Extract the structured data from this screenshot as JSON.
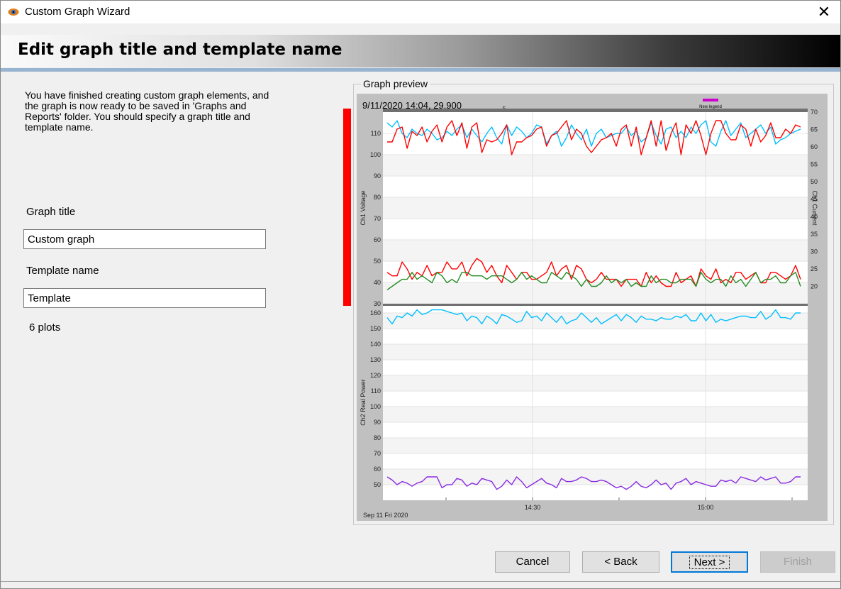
{
  "window": {
    "title": "Custom Graph Wizard",
    "close_symbol": "✕"
  },
  "header": {
    "title": "Edit graph title and template name"
  },
  "description": "You have finished creating custom graph elements, and the graph is now ready to be saved in 'Graphs and Reports' folder. You should specify a graph title and template name.",
  "form": {
    "graph_title_label": "Graph title",
    "graph_title_value": "Custom graph",
    "template_label": "Template name",
    "template_value": "Template",
    "plots_count": "6 plots"
  },
  "preview": {
    "group_label": "Graph preview",
    "cursor_readout": "9/11/2020 14:04, 29.900",
    "legend_label": "New legend",
    "legend_color": "#cc00cc",
    "date_label": "Sep 11 Fri 2020",
    "marker_color": "#ff0000"
  },
  "buttons": {
    "cancel": "Cancel",
    "back": "< Back",
    "next": "Next >",
    "finish": "Finish"
  },
  "chart_data": [
    {
      "type": "line",
      "ylabel": "Ch1 Voltage",
      "y2label": "Ch1 Current",
      "ylim": [
        30,
        120
      ],
      "y2lim": [
        15,
        70
      ],
      "yticks": [
        30,
        40,
        50,
        60,
        70,
        80,
        90,
        100,
        110
      ],
      "y2ticks": [
        20,
        25,
        30,
        35,
        40,
        45,
        50,
        55,
        60,
        65,
        70
      ],
      "xticks": [
        "14:30",
        "15:00"
      ],
      "series": [
        {
          "color": "#00bfff",
          "values": [
            115,
            113,
            116,
            110,
            108,
            112,
            110,
            109,
            112,
            110,
            107,
            108,
            111,
            109,
            112,
            114,
            108,
            112,
            109,
            106,
            110,
            113,
            108,
            105,
            114,
            109,
            113,
            111,
            108,
            110,
            114,
            113,
            105,
            109,
            111,
            104,
            108,
            114,
            110,
            107,
            112,
            104,
            110,
            112,
            108,
            109,
            110,
            110,
            113,
            109,
            111,
            106,
            108,
            115,
            109,
            105,
            112,
            113,
            108,
            111,
            108,
            113,
            110,
            114,
            116,
            106,
            104,
            111,
            116,
            109,
            112,
            115,
            108,
            110,
            112,
            114,
            110,
            113,
            105,
            107,
            108,
            110,
            111,
            112
          ]
        },
        {
          "color": "#ff0000",
          "values": [
            106,
            106,
            112,
            113,
            103,
            111,
            109,
            113,
            106,
            111,
            114,
            106,
            113,
            116,
            109,
            115,
            103,
            113,
            115,
            101,
            107,
            106,
            107,
            110,
            114,
            100,
            106,
            106,
            108,
            109,
            112,
            113,
            104,
            109,
            110,
            113,
            116,
            107,
            112,
            110,
            104,
            101,
            104,
            107,
            108,
            110,
            104,
            112,
            114,
            104,
            113,
            100,
            108,
            116,
            104,
            116,
            102,
            110,
            115,
            100,
            114,
            110,
            116,
            109,
            100,
            110,
            116,
            116,
            110,
            107,
            107,
            114,
            112,
            104,
            112,
            106,
            109,
            115,
            108,
            108,
            112,
            110,
            114,
            113
          ]
        },
        {
          "color": "#ff0000",
          "axis": "y2",
          "values": [
            24,
            23,
            23,
            27,
            25,
            22,
            24,
            23,
            26,
            23,
            24,
            24,
            27,
            25,
            25,
            27,
            23,
            26,
            28,
            27,
            24,
            26,
            23,
            21,
            26,
            24,
            22,
            24,
            24,
            22,
            22,
            23,
            24,
            27,
            23,
            25,
            26,
            22,
            26,
            25,
            22,
            21,
            22,
            24,
            22,
            22,
            22,
            20,
            22,
            22,
            22,
            20,
            24,
            21,
            23,
            21,
            20,
            20,
            24,
            21,
            22,
            23,
            20,
            25,
            23,
            22,
            25,
            21,
            22,
            21,
            24,
            24,
            22,
            23,
            24,
            21,
            21,
            24,
            24,
            23,
            22,
            23,
            26,
            22
          ]
        },
        {
          "color": "#228b22",
          "axis": "y2",
          "values": [
            19,
            20,
            21,
            22,
            22,
            24,
            22,
            23,
            22,
            21,
            24,
            23,
            21,
            22,
            21,
            24,
            24,
            23,
            23,
            23,
            22,
            23,
            23,
            23,
            22,
            21,
            22,
            24,
            22,
            23,
            22,
            21,
            21,
            24,
            23,
            22,
            24,
            23,
            22,
            20,
            22,
            20,
            20,
            21,
            23,
            21,
            22,
            21,
            22,
            20,
            21,
            20,
            20,
            23,
            21,
            22,
            22,
            21,
            21,
            22,
            22,
            22,
            20,
            24,
            22,
            21,
            22,
            22,
            20,
            23,
            21,
            22,
            20,
            22,
            24,
            21,
            22,
            22,
            23,
            21,
            21,
            23,
            24,
            20
          ]
        }
      ]
    },
    {
      "type": "line",
      "ylabel": "Ch2 Real Power",
      "ylim": [
        40,
        165
      ],
      "yticks": [
        50,
        60,
        70,
        80,
        90,
        100,
        110,
        120,
        130,
        140,
        150,
        160
      ],
      "xticks": [
        "14:30",
        "15:00"
      ],
      "series": [
        {
          "color": "#00bfff",
          "values": [
            157,
            153,
            158,
            157,
            160,
            158,
            162,
            159,
            160,
            162,
            162,
            162,
            161,
            160,
            159,
            160,
            155,
            158,
            157,
            153,
            158,
            156,
            153,
            159,
            158,
            156,
            154,
            155,
            161,
            157,
            158,
            155,
            160,
            157,
            154,
            158,
            153,
            155,
            156,
            160,
            157,
            154,
            157,
            153,
            155,
            157,
            159,
            155,
            159,
            157,
            154,
            158,
            156,
            156,
            155,
            157,
            156,
            156,
            158,
            157,
            159,
            155,
            155,
            160,
            155,
            159,
            154,
            156,
            155,
            156,
            157,
            158,
            158,
            157,
            157,
            161,
            156,
            158,
            162,
            157,
            157,
            156,
            160,
            160
          ]
        },
        {
          "color": "#8a2be2",
          "values": [
            55,
            53,
            50,
            52,
            51,
            49,
            51,
            52,
            55,
            55,
            55,
            48,
            50,
            50,
            54,
            53,
            49,
            51,
            50,
            54,
            53,
            52,
            47,
            49,
            53,
            50,
            55,
            52,
            48,
            50,
            52,
            54,
            51,
            50,
            48,
            54,
            52,
            52,
            53,
            55,
            54,
            52,
            52,
            53,
            52,
            50,
            48,
            49,
            47,
            49,
            52,
            49,
            48,
            50,
            53,
            50,
            51,
            47,
            51,
            52,
            54,
            50,
            52,
            51,
            50,
            49,
            49,
            53,
            52,
            53,
            51,
            55,
            54,
            53,
            52,
            55,
            53,
            54,
            55,
            51,
            51,
            52,
            55,
            55
          ]
        }
      ]
    }
  ]
}
